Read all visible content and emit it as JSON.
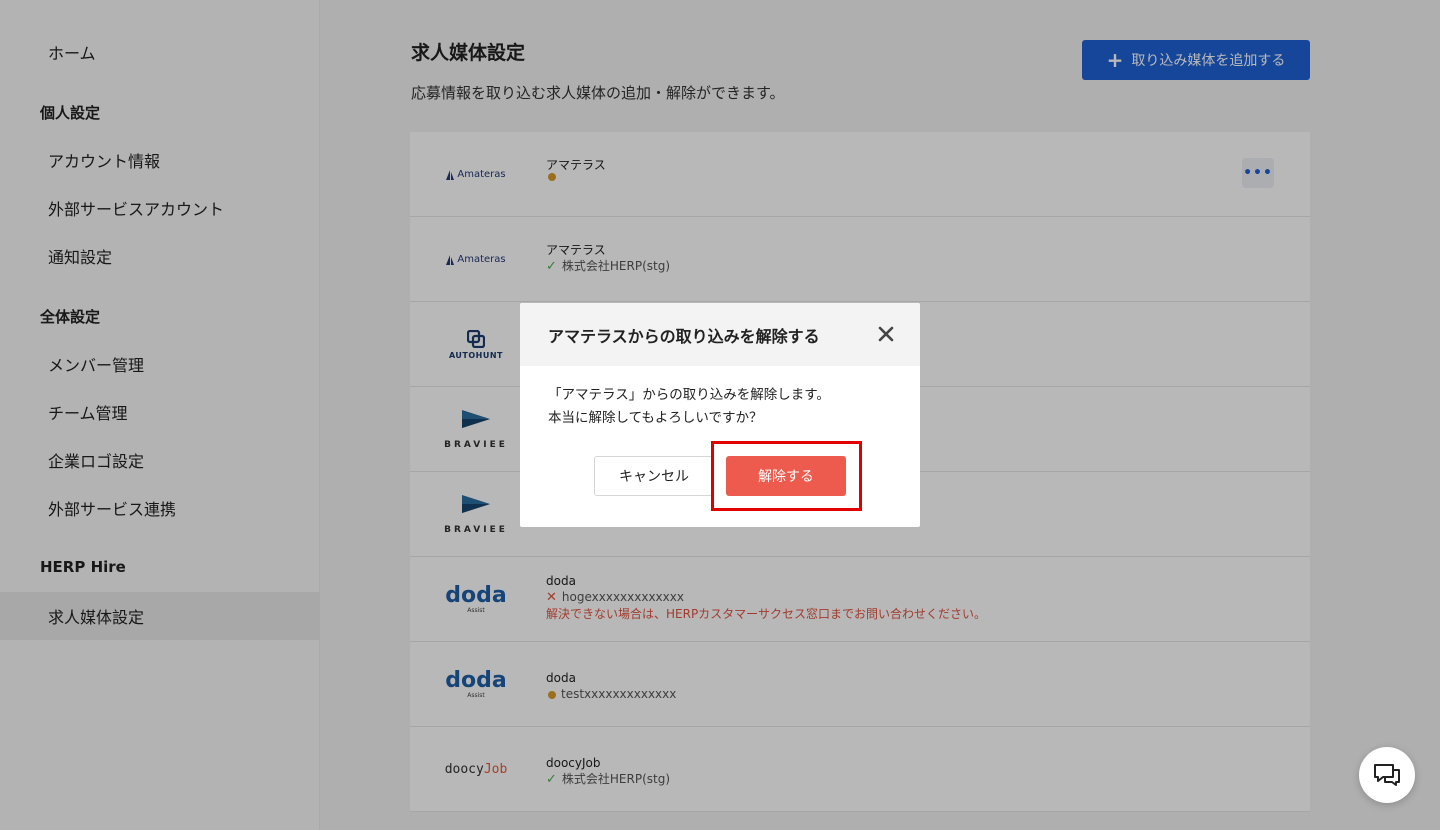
{
  "sidebar": {
    "home": "ホーム",
    "personal_heading": "個人設定",
    "personal_items": [
      "アカウント情報",
      "外部サービスアカウント",
      "通知設定"
    ],
    "global_heading": "全体設定",
    "global_items": [
      "メンバー管理",
      "チーム管理",
      "企業ロゴ設定",
      "外部サービス連携"
    ],
    "hire_heading": "HERP Hire",
    "hire_items": [
      "求人媒体設定"
    ]
  },
  "main": {
    "title": "求人媒体設定",
    "description": "応募情報を取り込む求人媒体の追加・解除ができます。",
    "add_button": "取り込み媒体を追加する",
    "rows": [
      {
        "logo": "amateras",
        "logo_text": "Amateras",
        "name": "アマテラス",
        "status": "pending",
        "status_text": ""
      },
      {
        "logo": "amateras",
        "logo_text": "Amateras",
        "name": "アマテラス",
        "status": "ok",
        "status_text": "株式会社HERP(stg)"
      },
      {
        "logo": "autohunt",
        "logo_text": "AUTOHUNT",
        "name": "",
        "status": "",
        "status_text": ""
      },
      {
        "logo": "braviee",
        "logo_text": "BRAVIEE",
        "name": "",
        "status": "",
        "status_text": ""
      },
      {
        "logo": "braviee",
        "logo_text": "BRAVIEE",
        "name": "",
        "status": "",
        "status_text": ""
      },
      {
        "logo": "doda",
        "logo_text": "doda",
        "logo_sub": "Assist",
        "name": "doda",
        "status": "error",
        "status_text": "hogexxxxxxxxxxxxx",
        "error_text": "解決できない場合は、HERPカスタマーサクセス窓口までお問い合わせください。"
      },
      {
        "logo": "doda",
        "logo_text": "doda",
        "logo_sub": "Assist",
        "name": "doda",
        "status": "pending",
        "status_text": "testxxxxxxxxxxxxx"
      },
      {
        "logo": "doocy",
        "logo_text": "doocy",
        "logo_text_accent": "Job",
        "name": "doocyJob",
        "status": "ok",
        "status_text": "株式会社HERP(stg)"
      }
    ]
  },
  "modal": {
    "title": "アマテラスからの取り込みを解除する",
    "body_line1": "「アマテラス」からの取り込みを解除します。",
    "body_line2": "本当に解除してもよろしいですか？",
    "cancel": "キャンセル",
    "confirm": "解除する"
  },
  "icons": {
    "add": "plus-icon",
    "more": "more-horizontal-icon",
    "close": "close-icon",
    "chat": "chat-bubbles-icon"
  },
  "colors": {
    "primary": "#1f62d6",
    "danger": "#ec5b4e",
    "highlight": "#e00000",
    "pending_dot": "#d99a2b",
    "ok_check": "#4caf50"
  }
}
